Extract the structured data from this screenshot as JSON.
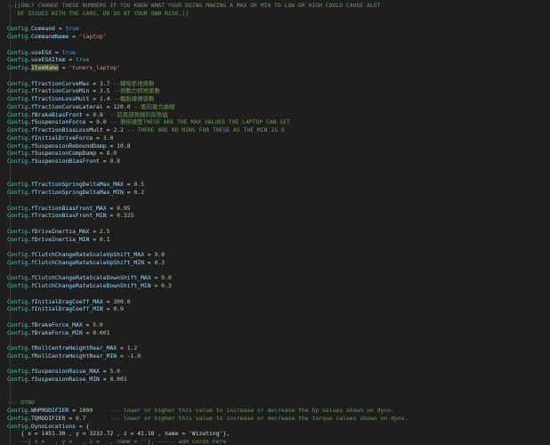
{
  "colors": {
    "background": "#1e1e1e",
    "comment": "#6a9955",
    "keyword": "#569cd6",
    "property": "#9cdcfe",
    "config": "#4ec9b0",
    "number": "#b5cea8",
    "string": "#ce9178"
  },
  "lines": [
    {
      "kind": "comment",
      "text": "--[[ONLY CHANGE THESE NUMBERS IF YOU KNOW WHAT YOUR DOING MAKING A MAX OR MIN TO LOW OR HIGH COULD CAUSE ALOT"
    },
    {
      "kind": "comment",
      "text": "   OF ISSUES WITH THE CARS. DO SO AT YOUR OWN RISK.]]"
    },
    {
      "kind": "blank"
    },
    {
      "kind": "assign",
      "prop": "Command",
      "value": "true",
      "vtype": "bool"
    },
    {
      "kind": "assign",
      "prop": "CommandName",
      "value": "'laptop'",
      "vtype": "str"
    },
    {
      "kind": "blank"
    },
    {
      "kind": "assign",
      "prop": "useESX",
      "value": "true",
      "vtype": "bool"
    },
    {
      "kind": "assign",
      "prop": "useESXItem",
      "value": "true",
      "vtype": "bool"
    },
    {
      "kind": "assign",
      "prop": "ItemName",
      "value": "'tuners_laptop'",
      "vtype": "str",
      "highlight": true
    },
    {
      "kind": "blank"
    },
    {
      "kind": "assign",
      "prop": "fTractionCurveMax",
      "value": "3.7",
      "vtype": "num",
      "comment": "--轉彎抓地係數"
    },
    {
      "kind": "assign",
      "prop": "fTractionCurveMin",
      "value": "3.5",
      "vtype": "num",
      "comment": "--剎動力抓地係數"
    },
    {
      "kind": "assign",
      "prop": "fTractionLossMult",
      "value": "1.4",
      "vtype": "num",
      "comment": "--輪胎摩擦係數"
    },
    {
      "kind": "assign",
      "prop": "fTractionCurveLateral",
      "value": "120.0",
      "vtype": "num",
      "comment": "--側向著力曲線"
    },
    {
      "kind": "assign",
      "prop": "fBrakeBiasFront",
      "value": "0.8",
      "vtype": "num",
      "comment": "--前頁部煞錶的前煞值"
    },
    {
      "kind": "assign",
      "prop": "fSuspensionForce",
      "value": "9.0",
      "vtype": "num",
      "comment": "-- 懸掛硬度THESE ARE THE MAX VALUES THE LAPTOP CAN SET"
    },
    {
      "kind": "assign",
      "prop": "fTractionBiasLossMult",
      "value": "2.2",
      "vtype": "num",
      "comment": "-- THERE ARE NO MINS FOR THESE AS THE MIN IS 0"
    },
    {
      "kind": "assign",
      "prop": "fInitialDriveForce",
      "value": "3.0",
      "vtype": "num"
    },
    {
      "kind": "assign",
      "prop": "fSuspensionReboundDamp",
      "value": "10.8",
      "vtype": "num"
    },
    {
      "kind": "assign",
      "prop": "fSuspensionCompDamp",
      "value": "8.0",
      "vtype": "num"
    },
    {
      "kind": "assign",
      "prop": "fSuspensionBiasFront",
      "value": "0.8",
      "vtype": "num"
    },
    {
      "kind": "blank"
    },
    {
      "kind": "blank"
    },
    {
      "kind": "assign",
      "prop": "fTractionSpringDeltaMax_MAX",
      "value": "0.5",
      "vtype": "num"
    },
    {
      "kind": "assign",
      "prop": "fTractionSpringDeltaMax_MIN",
      "value": "0.2",
      "vtype": "num"
    },
    {
      "kind": "blank"
    },
    {
      "kind": "assign",
      "prop": "fTractionBiasFront_MAX",
      "value": "0.95",
      "vtype": "num"
    },
    {
      "kind": "assign",
      "prop": "fTractionBiasFront_MIN",
      "value": "0.325",
      "vtype": "num"
    },
    {
      "kind": "blank"
    },
    {
      "kind": "assign",
      "prop": "fDriveInertia_MAX",
      "value": "2.5",
      "vtype": "num"
    },
    {
      "kind": "assign",
      "prop": "fDriveInertia_MIN",
      "value": "0.1",
      "vtype": "num"
    },
    {
      "kind": "blank"
    },
    {
      "kind": "assign",
      "prop": "fClutchChangeRateScaleUpShift_MAX",
      "value": "9.0",
      "vtype": "num"
    },
    {
      "kind": "assign",
      "prop": "fClutchChangeRateScaleUpShift_MIN",
      "value": "0.3",
      "vtype": "num"
    },
    {
      "kind": "blank"
    },
    {
      "kind": "assign",
      "prop": "fClutchChangeRateScaleDownShift_MAX",
      "value": "9.0",
      "vtype": "num"
    },
    {
      "kind": "assign",
      "prop": "fClutchChangeRateScaleDownShift_MIN",
      "value": "0.3",
      "vtype": "num"
    },
    {
      "kind": "blank"
    },
    {
      "kind": "assign",
      "prop": "fInitialDragCoeff_MAX",
      "value": "300.0",
      "vtype": "num"
    },
    {
      "kind": "assign",
      "prop": "fInitialDragCoeff_MIN",
      "value": "0.9",
      "vtype": "num"
    },
    {
      "kind": "blank"
    },
    {
      "kind": "assign",
      "prop": "fBrakeForce_MAX",
      "value": "5.0",
      "vtype": "num"
    },
    {
      "kind": "assign",
      "prop": "fBrakeForce_MIN",
      "value": "0.001",
      "vtype": "num"
    },
    {
      "kind": "blank"
    },
    {
      "kind": "assign",
      "prop": "fRollCentreHeightRear_MAX",
      "value": "1.2",
      "vtype": "num"
    },
    {
      "kind": "assign",
      "prop": "fRollCentreHeightRear_MIN",
      "value": "-1.0",
      "vtype": "num"
    },
    {
      "kind": "blank"
    },
    {
      "kind": "assign",
      "prop": "fSuspensionRaise_MAX",
      "value": "5.0",
      "vtype": "num"
    },
    {
      "kind": "assign",
      "prop": "fSuspensionRaise_MIN",
      "value": "0.001",
      "vtype": "num"
    },
    {
      "kind": "blank"
    },
    {
      "kind": "blank"
    },
    {
      "kind": "comment",
      "text": "--- DYNO"
    },
    {
      "kind": "assign",
      "prop": "WHPMODIFIER",
      "value": "1000",
      "vtype": "num",
      "comment": "--- lower or higher this value to increase or decrease the hp values shown on dyno."
    },
    {
      "kind": "assign",
      "prop": "TQMODIFIER",
      "value": "0.7",
      "vtype": "num",
      "comment": "--- lower or higher this value to increase or decrease the torque values shown on dyno."
    },
    {
      "kind": "assign",
      "prop": "DynoLocations",
      "value": "{",
      "vtype": "op"
    },
    {
      "kind": "coord",
      "text": "    { x = 1451.30 , y = 3232.72 , z = 41.16 , name = 'Wizating'},"
    },
    {
      "kind": "comment",
      "text": "    --{ x =   , y =   , z =   , name = ''}, ----- add cords here"
    }
  ]
}
